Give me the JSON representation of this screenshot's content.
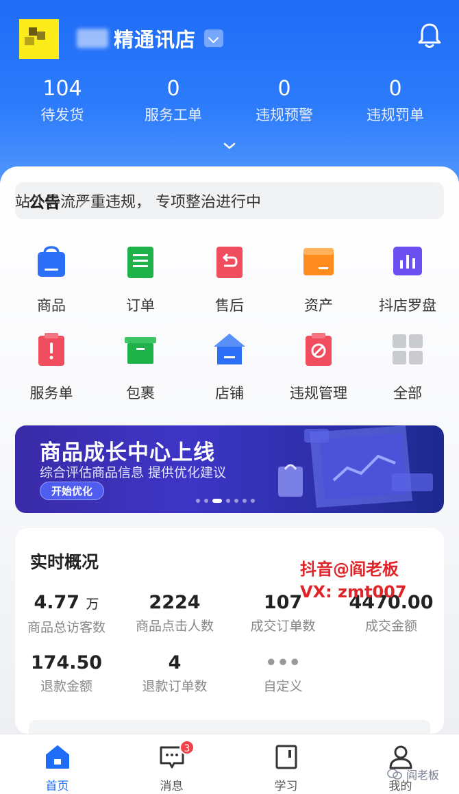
{
  "header": {
    "shop_name": "精通讯店",
    "colors": {
      "primary": "#1f6cf7",
      "logo": "#fcec1c"
    },
    "stats": [
      {
        "value": "104",
        "label": "待发货"
      },
      {
        "value": "0",
        "label": "服务工单"
      },
      {
        "value": "0",
        "label": "违规预警"
      },
      {
        "value": "0",
        "label": "违规罚单"
      }
    ]
  },
  "notice": {
    "tag": "公告",
    "message": "站外导流严重违规， 专项整治进行中"
  },
  "shortcuts": [
    {
      "label": "商品",
      "icon": "shopping-bag-icon",
      "color": "#2b6ff6"
    },
    {
      "label": "订单",
      "icon": "order-clipboard-icon",
      "color": "#20b24a"
    },
    {
      "label": "售后",
      "icon": "after-sale-icon",
      "color": "#f04d5f"
    },
    {
      "label": "资产",
      "icon": "wallet-icon",
      "color": "#ff8a1d"
    },
    {
      "label": "抖店罗盘",
      "icon": "chart-compass-icon",
      "color": "#6b4ff0"
    },
    {
      "label": "服务单",
      "icon": "service-alert-icon",
      "color": "#f04d5f"
    },
    {
      "label": "包裹",
      "icon": "package-box-icon",
      "color": "#20b24a"
    },
    {
      "label": "店铺",
      "icon": "store-house-icon",
      "color": "#2b6ff6"
    },
    {
      "label": "违规管理",
      "icon": "violation-icon",
      "color": "#f04d5f"
    },
    {
      "label": "全部",
      "icon": "all-grid-icon",
      "color": "#c9cbcf"
    }
  ],
  "banner": {
    "title": "商品成长中心上线",
    "subtitle": "综合评估商品信息 提供优化建议",
    "button": "开始优化",
    "slide_count": 7,
    "active_slide": 3
  },
  "realtime": {
    "title": "实时概况",
    "metrics": [
      {
        "value": "4.77",
        "unit": "万",
        "label": "商品总访客数"
      },
      {
        "value": "2224",
        "unit": "",
        "label": "商品点击人数"
      },
      {
        "value": "107",
        "unit": "",
        "label": "成交订单数"
      },
      {
        "value": "4470.00",
        "unit": "",
        "label": "成交金额"
      },
      {
        "value": "174.50",
        "unit": "",
        "label": "退款金额"
      },
      {
        "value": "4",
        "unit": "",
        "label": "退款订单数"
      },
      {
        "value": "•••",
        "unit": "",
        "label": "自定义"
      }
    ]
  },
  "watermark": {
    "line1": "抖音@阎老板",
    "line2": "VX: zmt007",
    "corner": "阎老板"
  },
  "tabbar": [
    {
      "label": "首页",
      "icon": "home-icon",
      "active": true
    },
    {
      "label": "消息",
      "icon": "message-icon",
      "badge": "3"
    },
    {
      "label": "学习",
      "icon": "book-icon"
    },
    {
      "label": "我的",
      "icon": "profile-icon"
    }
  ]
}
